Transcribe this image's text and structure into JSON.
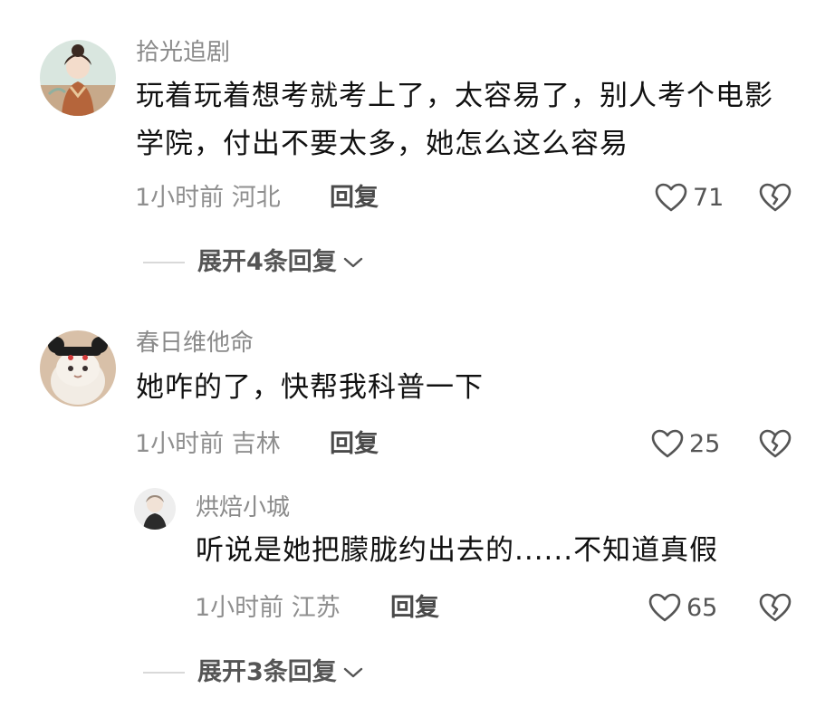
{
  "comments": [
    {
      "username": "拾光追剧",
      "text": "玩着玩着想考就考上了，太容易了，别人考个电影学院，付出不要太多，她怎么这么容易",
      "time": "1小时前",
      "location": "河北",
      "reply_label": "回复",
      "likes": "71",
      "expand_label": "展开4条回复"
    },
    {
      "username": "春日维他命",
      "text": "她咋的了，快帮我科普一下",
      "time": "1小时前",
      "location": "吉林",
      "reply_label": "回复",
      "likes": "25",
      "reply": {
        "username": "烘焙小城",
        "text": "听说是她把朦胧约出去的......不知道真假",
        "time": "1小时前",
        "location": "江苏",
        "reply_label": "回复",
        "likes": "65"
      },
      "expand_label": "展开3条回复"
    }
  ],
  "icons": {
    "like": "heart-outline-icon",
    "dislike": "broken-heart-icon",
    "expand": "chevron-down-icon"
  },
  "colors": {
    "username": "#8a8a8a",
    "content": "#111111",
    "meta": "#8f8f8f"
  }
}
